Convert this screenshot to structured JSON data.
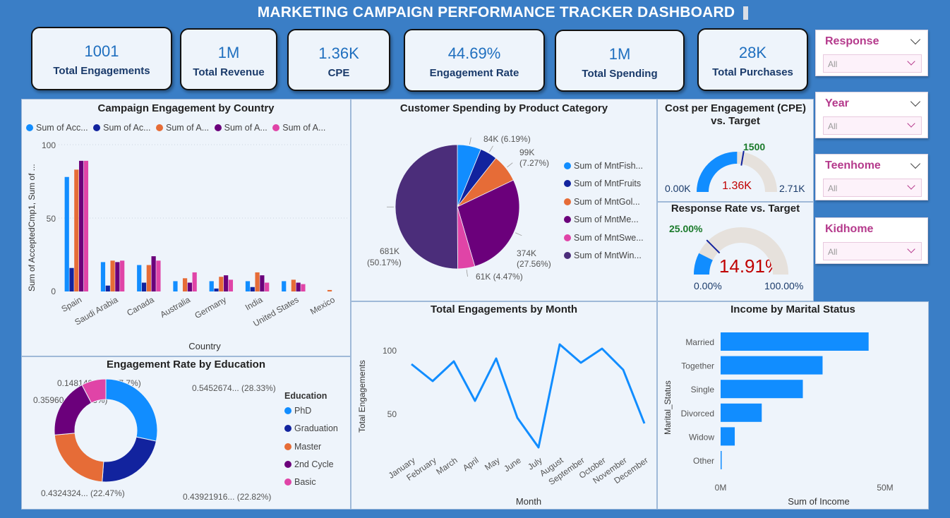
{
  "header": {
    "title": "MARKETING CAMPAIGN PERFORMANCE TRACKER DASHBOARD"
  },
  "kpis": [
    {
      "value": "1001",
      "label": "Total Engagements"
    },
    {
      "value": "1M",
      "label": "Total Revenue"
    },
    {
      "value": "1.36K",
      "label": "CPE"
    },
    {
      "value": "44.69%",
      "label": "Engagement Rate"
    },
    {
      "value": "1M",
      "label": "Total Spending"
    },
    {
      "value": "28K",
      "label": "Total Purchases"
    }
  ],
  "slicers": [
    {
      "label": "Response",
      "value": "All"
    },
    {
      "label": "Year",
      "value": "All"
    },
    {
      "label": "Teenhome",
      "value": "All"
    },
    {
      "label": "Kidhome",
      "value": "All"
    }
  ],
  "colors": {
    "blue": "#118dff",
    "navy": "#12239e",
    "orange": "#e66c37",
    "purple": "#6b007b",
    "pink": "#e044a7",
    "darkviolet": "#4b2d7a",
    "gauge_track": "#e6e1dc"
  },
  "country_chart": {
    "title": "Campaign Engagement by Country",
    "xlabel": "Country",
    "ylabel": "Sum of AcceptedCmp1, Sum of ...",
    "yticks": [
      "100",
      "50",
      "0"
    ],
    "legend": [
      "Sum of Acc...",
      "Sum of Ac...",
      "Sum of A...",
      "Sum of A...",
      "Sum of A..."
    ]
  },
  "category_chart": {
    "title": "Customer Spending by Product Category",
    "legend": [
      "Sum of MntFish...",
      "Sum of MntFruits",
      "Sum of MntGol...",
      "Sum of MntMe...",
      "Sum of MntSwe...",
      "Sum of MntWin..."
    ],
    "labels": {
      "fish": "84K (6.19%)",
      "gold_a": "99K",
      "gold_b": "(7.27%)",
      "meat_a": "374K",
      "meat_b": "(27.56%)",
      "sweet": "61K (4.47%)",
      "wine_a": "681K",
      "wine_b": "(50.17%)"
    }
  },
  "cpe_gauge": {
    "title_a": "Cost per Engagement (CPE)",
    "title_b": "vs. Target",
    "value": "1.36K",
    "target": "1500",
    "min": "0.00K",
    "max": "2.71K",
    "fill_fraction": 0.502,
    "target_fraction": 0.553
  },
  "response_gauge": {
    "title": "Response Rate vs. Target",
    "value": "14.91%",
    "target": "25.00%",
    "min": "0.00%",
    "max": "100.00%",
    "fill_fraction": 0.1491,
    "target_fraction": 0.25
  },
  "education_chart": {
    "title": "Engagement Rate by Education",
    "legend_title": "Education",
    "legend": [
      "PhD",
      "Graduation",
      "Master",
      "2nd Cycle",
      "Basic"
    ],
    "labels": {
      "phd": "0.5452674... (28.33%)",
      "grad": "0.43921916... (22.82%)",
      "master": "0.4324324... (22.47%)",
      "cycle": "0.35960... (18.68%)",
      "basic": "0.148148148... (7.7%)"
    }
  },
  "month_chart": {
    "title": "Total Engagements by Month",
    "xlabel": "Month",
    "ylabel": "Total Engagements",
    "yticks": [
      "100",
      "50"
    ]
  },
  "marital_chart": {
    "title": "Income by Marital Status",
    "xlabel": "Sum of Income",
    "ylabel": "Marital_Status",
    "xticks": [
      "0M",
      "50M"
    ]
  },
  "chart_data": [
    {
      "type": "bar",
      "title": "Campaign Engagement by Country",
      "categories": [
        "Spain",
        "Saudi Arabia",
        "Canada",
        "Australia",
        "Germany",
        "India",
        "United States",
        "Mexico"
      ],
      "series": [
        {
          "name": "Sum of Acc...",
          "values": [
            78,
            20,
            18,
            7,
            7,
            7,
            7,
            0
          ]
        },
        {
          "name": "Sum of Ac...",
          "values": [
            16,
            4,
            6,
            0,
            2,
            3,
            0,
            0
          ]
        },
        {
          "name": "Sum of A...",
          "values": [
            83,
            21,
            18,
            9,
            10,
            13,
            8,
            1
          ]
        },
        {
          "name": "Sum of A...",
          "values": [
            89,
            20,
            24,
            6,
            11,
            11,
            6,
            0
          ]
        },
        {
          "name": "Sum of A...",
          "values": [
            89,
            21,
            21,
            13,
            8,
            6,
            5,
            0
          ]
        }
      ],
      "ylim": [
        0,
        100
      ]
    },
    {
      "type": "pie",
      "title": "Customer Spending by Product Category",
      "categories": [
        "Sum of MntFish...",
        "Sum of MntFruits",
        "Sum of MntGol...",
        "Sum of MntMe...",
        "Sum of MntSwe...",
        "Sum of MntWin..."
      ],
      "values": [
        84,
        61,
        99,
        374,
        61,
        681
      ],
      "percentages": [
        6.19,
        4.5,
        7.27,
        27.56,
        4.47,
        50.17
      ]
    },
    {
      "type": "pie",
      "title": "Engagement Rate by Education",
      "categories": [
        "PhD",
        "Graduation",
        "Master",
        "2nd Cycle",
        "Basic"
      ],
      "values": [
        0.5452674,
        0.43921916,
        0.4324324,
        0.3596,
        0.148148148
      ],
      "percentages": [
        28.33,
        22.82,
        22.47,
        18.68,
        7.7
      ]
    },
    {
      "type": "line",
      "title": "Total Engagements by Month",
      "categories": [
        "January",
        "February",
        "March",
        "April",
        "May",
        "June",
        "July",
        "August",
        "September",
        "October",
        "November",
        "December"
      ],
      "values": [
        96,
        84,
        98,
        70,
        100,
        58,
        37,
        110,
        97,
        107,
        92,
        54
      ],
      "ylim": [
        30,
        115
      ]
    },
    {
      "type": "bar",
      "title": "Income by Marital Status",
      "categories": [
        "Married",
        "Together",
        "Single",
        "Divorced",
        "Widow",
        "Other"
      ],
      "values": [
        45,
        31,
        25,
        12.5,
        4.3,
        0.3
      ],
      "xlim": [
        0,
        50
      ]
    }
  ]
}
